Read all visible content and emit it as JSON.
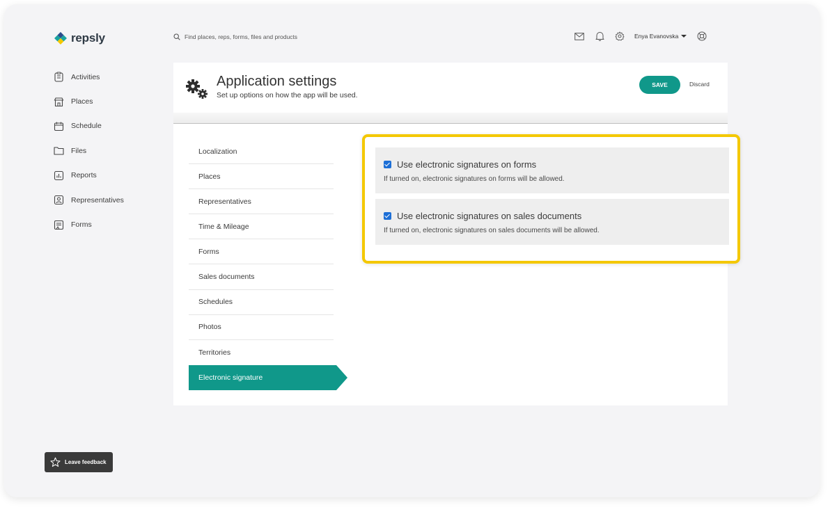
{
  "brand": {
    "name": "repsly"
  },
  "search": {
    "placeholder": "Find places, reps, forms, files and products"
  },
  "topbar": {
    "user_name": "Enya Evanovska"
  },
  "sidebar": {
    "items": [
      {
        "label": "Activities",
        "icon": "clipboard-icon"
      },
      {
        "label": "Places",
        "icon": "store-icon"
      },
      {
        "label": "Schedule",
        "icon": "calendar-icon"
      },
      {
        "label": "Files",
        "icon": "folder-icon"
      },
      {
        "label": "Reports",
        "icon": "bar-chart-icon"
      },
      {
        "label": "Representatives",
        "icon": "person-icon"
      },
      {
        "label": "Forms",
        "icon": "form-icon"
      }
    ]
  },
  "header": {
    "title": "Application settings",
    "subtitle": "Set up options on how the app will be used.",
    "save_label": "SAVE",
    "discard_label": "Discard"
  },
  "settings_menu": {
    "items": [
      "Localization",
      "Places",
      "Representatives",
      "Time & Mileage",
      "Forms",
      "Sales documents",
      "Schedules",
      "Photos",
      "Territories",
      "Electronic signature"
    ],
    "active": "Electronic signature"
  },
  "options": [
    {
      "title": "Use electronic signatures on forms",
      "description": "If turned on, electronic signatures on forms will be allowed.",
      "checked": true
    },
    {
      "title": "Use electronic signatures on sales documents",
      "description": "If turned on, electronic signatures on sales documents will be allowed.",
      "checked": true
    }
  ],
  "feedback": {
    "label": "Leave feedback"
  },
  "colors": {
    "accent": "#10988a",
    "highlight": "#f4c800",
    "checkbox": "#1d6fd6"
  }
}
